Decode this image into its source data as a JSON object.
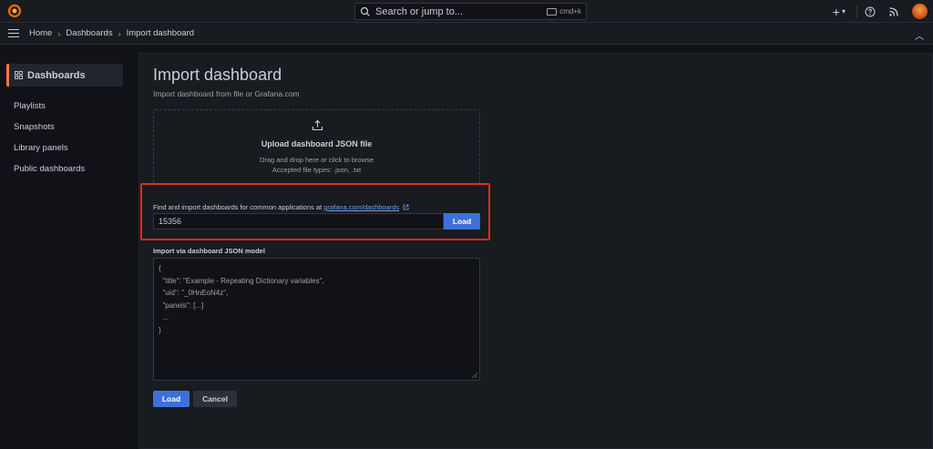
{
  "topbar": {
    "search_placeholder": "Search or jump to...",
    "search_shortcut": "cmd+k",
    "plus_label": "+",
    "icons": [
      "grafana-logo-icon",
      "search-icon",
      "keyboard-icon",
      "plus-icon",
      "help-icon",
      "news-icon",
      "avatar"
    ]
  },
  "breadcrumb": {
    "items": [
      "Home",
      "Dashboards",
      "Import dashboard"
    ]
  },
  "sidebar": {
    "section_title": "Dashboards",
    "items": [
      {
        "label": "Playlists"
      },
      {
        "label": "Snapshots"
      },
      {
        "label": "Library panels"
      },
      {
        "label": "Public dashboards"
      }
    ]
  },
  "main": {
    "title": "Import dashboard",
    "subtitle": "Import dashboard from file or Grafana.com",
    "upload": {
      "title": "Upload dashboard JSON file",
      "line1": "Drag and drop here or click to browse",
      "line2": "Accepted file types: .json, .txt"
    },
    "gcom": {
      "label": "Find and import dashboards for common applications at",
      "link": "grafana.com/dashboards",
      "input_value": "15356",
      "load_label": "Load"
    },
    "json_model": {
      "label": "Import via dashboard JSON model",
      "lines": [
        "{",
        "  \"title\": \"Example - Repeating Dictionary variables\",",
        "  \"uid\": \"_0HnEoN4z\",",
        "  \"panels\": [...]",
        "  ...",
        "}"
      ]
    },
    "buttons": {
      "load": "Load",
      "cancel": "Cancel"
    }
  },
  "colors": {
    "accent_primary": "#3d71d9",
    "highlight_border": "#e8291c",
    "sidebar_active_bar": "#ff7a3d",
    "background": "#111217",
    "panel": "#181b1f"
  }
}
